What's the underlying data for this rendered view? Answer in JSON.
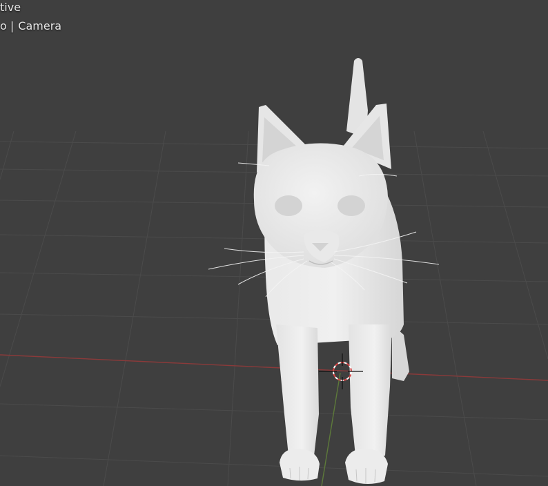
{
  "viewport": {
    "view_name": "tive",
    "object_prefix": "o",
    "separator": "|",
    "object_name": "Camera"
  },
  "scene": {
    "object": "cat-model",
    "colors": {
      "background": "#3f3f3f",
      "grid": "#4d4d4d",
      "x_axis": "#8b3a3a",
      "y_axis": "#5d7a3a",
      "model": "#e2e2e2"
    }
  }
}
